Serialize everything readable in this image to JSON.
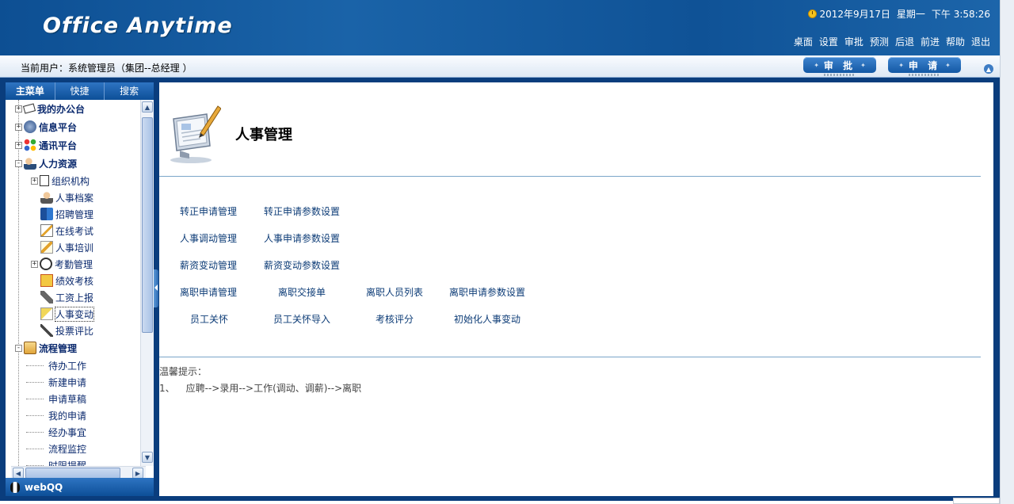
{
  "header": {
    "logo": "Office Anytime",
    "clock": {
      "date": "2012年9月17日",
      "weekday": "星期一",
      "time": "下午  3:58:26"
    },
    "nav": [
      "桌面",
      "设置",
      "审批",
      "预测",
      "后退",
      "前进",
      "帮助",
      "退出"
    ]
  },
  "userbar": {
    "current_user": "当前用户：系统管理员（集团--总经理 ）",
    "approve_button": "审 批",
    "apply_button": "申 请"
  },
  "sidebar": {
    "tabs": [
      "主菜单",
      "快捷",
      "搜索"
    ],
    "top_nodes": [
      {
        "label": "我的办公台",
        "icon": "desk-icon",
        "toggle": "+"
      },
      {
        "label": "信息平台",
        "icon": "globe-icon",
        "toggle": "+"
      },
      {
        "label": "通讯平台",
        "icon": "communication-icon",
        "toggle": "+"
      },
      {
        "label": "人力资源",
        "icon": "hr-icon",
        "toggle": "-"
      }
    ],
    "hr_children": [
      {
        "label": "组织机构",
        "icon": "org-icon",
        "toggle": "+"
      },
      {
        "label": "人事档案",
        "icon": "person-icon"
      },
      {
        "label": "招聘管理",
        "icon": "book-icon"
      },
      {
        "label": "在线考试",
        "icon": "edit-icon"
      },
      {
        "label": "人事培训",
        "icon": "training-icon"
      },
      {
        "label": "考勤管理",
        "icon": "clock-icon",
        "toggle": "+"
      },
      {
        "label": "绩效考核",
        "icon": "performance-icon"
      },
      {
        "label": "工资上报",
        "icon": "wage-icon"
      },
      {
        "label": "人事变动",
        "icon": "change-icon",
        "selected": true
      },
      {
        "label": "投票评比",
        "icon": "vote-icon"
      }
    ],
    "flow_node": {
      "label": "流程管理",
      "icon": "workflow-icon",
      "toggle": "-"
    },
    "flow_children": [
      "待办工作",
      "新建申请",
      "申请草稿",
      "我的申请",
      "经办事宜",
      "流程监控",
      "时限提醒"
    ],
    "webqq": "webQQ"
  },
  "main": {
    "title": "人事管理",
    "link_rows": [
      [
        "转正申请管理",
        "转正申请参数设置"
      ],
      [
        "人事调动管理",
        "人事申请参数设置"
      ],
      [
        "薪资变动管理",
        "薪资变动参数设置"
      ],
      [
        "离职申请管理",
        "离职交接单",
        "离职人员列表",
        "离职申请参数设置"
      ],
      [
        "员工关怀",
        "员工关怀导入",
        "考核评分",
        "初始化人事变动"
      ]
    ],
    "tip_title": "温馨提示：",
    "tip_number": "1、",
    "tip_text": "应聘-->录用-->工作(调动、调薪)-->离职"
  },
  "colors": {
    "header_blue": "#0f5296",
    "frame_blue": "#0a3d7d",
    "link_blue": "#0d3c77",
    "tree_text": "#0b2a6e"
  }
}
